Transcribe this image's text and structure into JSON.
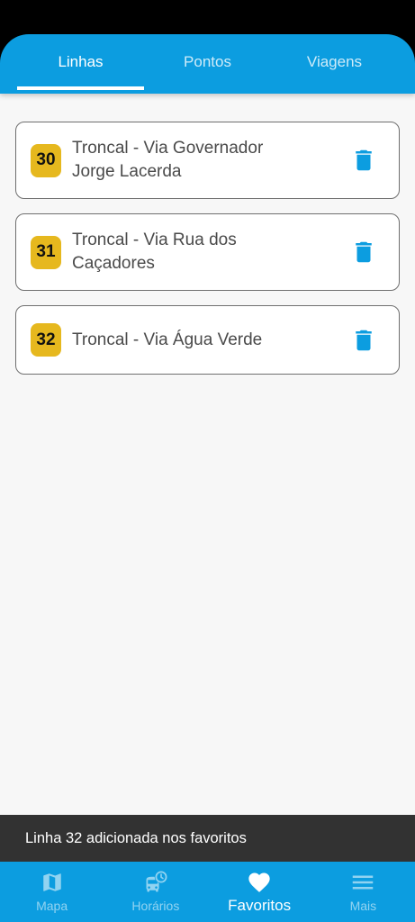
{
  "header": {
    "tabs": [
      {
        "label": "Linhas",
        "active": true
      },
      {
        "label": "Pontos",
        "active": false
      },
      {
        "label": "Viagens",
        "active": false
      }
    ]
  },
  "favorites": [
    {
      "number": "30",
      "name": "Troncal - Via Governador Jorge Lacerda",
      "action_icon": "trash-icon"
    },
    {
      "number": "31",
      "name": "Troncal - Via Rua dos Caçadores",
      "action_icon": "trash-icon"
    },
    {
      "number": "32",
      "name": "Troncal - Via Água Verde",
      "action_icon": "trash-icon"
    }
  ],
  "snackbar": {
    "message": "Linha 32 adicionada nos favoritos"
  },
  "bottom_nav": {
    "items": [
      {
        "label": "Mapa",
        "icon": "map-icon",
        "active": false
      },
      {
        "label": "Horários",
        "icon": "bus-clock-icon",
        "active": false
      },
      {
        "label": "Favoritos",
        "icon": "heart-icon",
        "active": true
      },
      {
        "label": "Mais",
        "icon": "menu-icon",
        "active": false
      }
    ]
  },
  "colors": {
    "primary": "#0c9de0",
    "badge": "#e6b81e",
    "snackbar": "#323232",
    "background": "#f7f7f7"
  }
}
